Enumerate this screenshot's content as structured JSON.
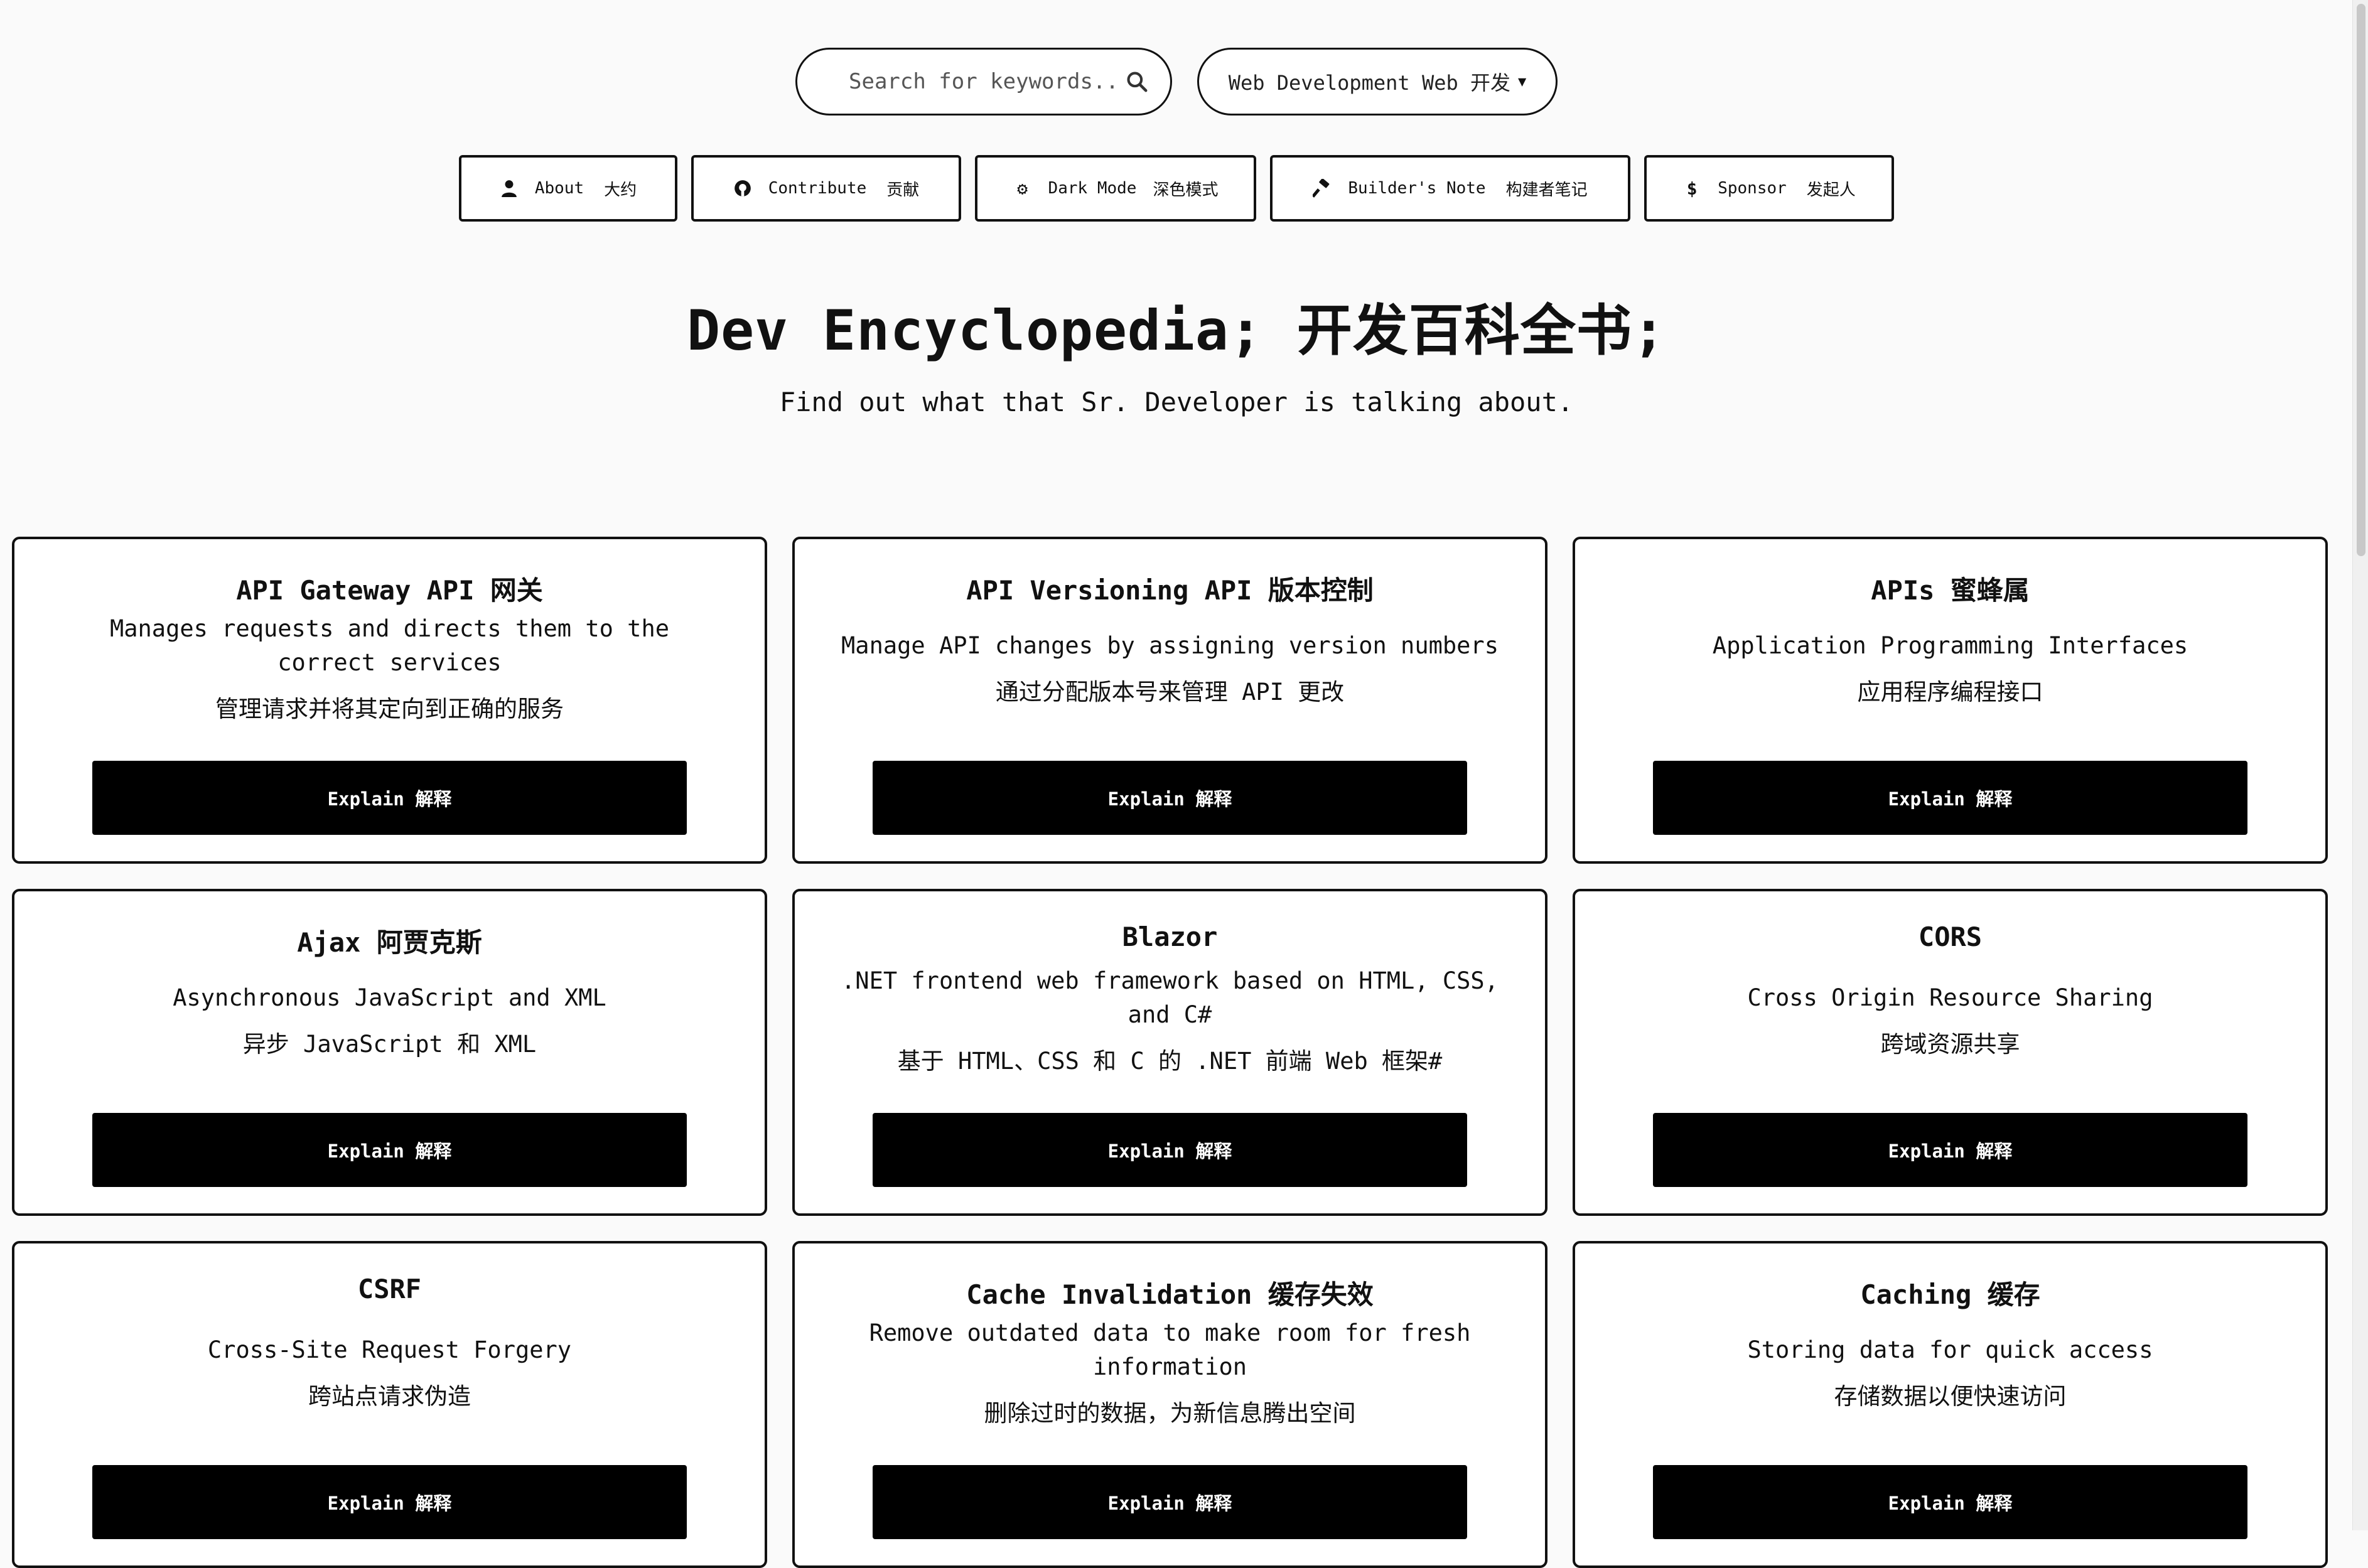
{
  "search": {
    "placeholder": "Search for keywords.."
  },
  "category_select": {
    "selected": "Web Development Web 开发"
  },
  "nav": {
    "about": {
      "label": "About",
      "zh": "大约"
    },
    "contribute": {
      "label": "Contribute",
      "zh": "贡献"
    },
    "dark_mode": {
      "label": "Dark Mode",
      "zh": "深色模式"
    },
    "builders_note": {
      "label": "Builder's Note",
      "zh": "构建者笔记"
    },
    "sponsor": {
      "label": "Sponsor",
      "zh": "发起人"
    }
  },
  "hero": {
    "title": "Dev Encyclopedia;  开发百科全书;",
    "subtitle": "Find out what that Sr. Developer is talking about."
  },
  "explain_label": "Explain 解释",
  "cards": [
    {
      "title": "API Gateway API 网关",
      "desc": "Manages requests and directs them to the correct services",
      "zh": "管理请求并将其定向到正确的服务"
    },
    {
      "title": "API Versioning API 版本控制",
      "desc": "Manage API changes by assigning version numbers",
      "zh": "通过分配版本号来管理 API 更改"
    },
    {
      "title": "APIs 蜜蜂属",
      "desc": "Application Programming Interfaces",
      "zh": "应用程序编程接口"
    },
    {
      "title": "Ajax 阿贾克斯",
      "desc": "Asynchronous JavaScript and XML",
      "zh": "异步 JavaScript 和 XML"
    },
    {
      "title": "Blazor",
      "desc": ".NET frontend web framework based on HTML, CSS, and C#",
      "zh": "基于 HTML、CSS 和 C 的 .NET 前端 Web 框架#"
    },
    {
      "title": "CORS",
      "desc": "Cross Origin Resource Sharing",
      "zh": "跨域资源共享"
    },
    {
      "title": "CSRF",
      "desc": "Cross-Site Request Forgery",
      "zh": "跨站点请求伪造"
    },
    {
      "title": "Cache Invalidation 缓存失效",
      "desc": "Remove outdated data to make room for fresh information",
      "zh": "删除过时的数据，为新信息腾出空间"
    },
    {
      "title": "Caching 缓存",
      "desc": "Storing data for quick access",
      "zh": "存储数据以便快速访问"
    }
  ]
}
